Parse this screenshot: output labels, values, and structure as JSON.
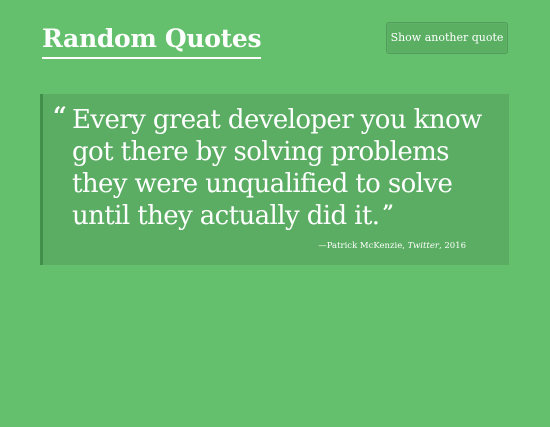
{
  "header": {
    "title": "Random Quotes",
    "show_another_label": "Show another quote"
  },
  "quote": {
    "open_mark": "“",
    "text": "Every great developer you know got there by solving problems they were unqualified to solve until they actually did it.",
    "close_mark": "”",
    "attribution_dash": "—",
    "author": "Patrick McKenzie",
    "comma": ", ",
    "source": "Twitter",
    "year_separator": ", ",
    "year": "2016"
  },
  "colors": {
    "background": "#64c06c",
    "card": "#5aad62",
    "card_border": "#418f4a",
    "button": "#5aaf63",
    "text": "#ffffff"
  },
  "icons": {
    "open_quote": "left-double-quotation-mark",
    "close_quote": "right-double-quotation-mark"
  }
}
